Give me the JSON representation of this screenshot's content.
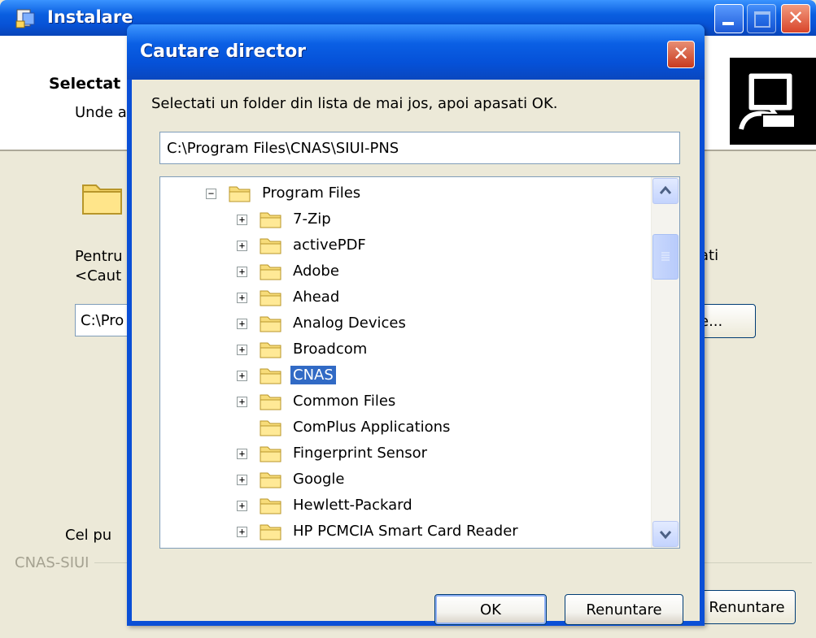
{
  "background_window": {
    "title": "Instalare",
    "header_title": "Selectat",
    "header_subtitle": "Unde a",
    "text_line1": "Pentru",
    "text_line2": "<Caut",
    "text_right": "ati",
    "path_value": "C:\\Pro",
    "browse_label": "e...",
    "space_label": "Cel pu",
    "group_label": "CNAS-SIUI",
    "cancel_label": "Renuntare"
  },
  "dialog": {
    "title": "Cautare director",
    "instruction": "Selectati un folder din lista de mai jos, apoi apasati OK.",
    "path_value": "C:\\Program Files\\CNAS\\SIUI-PNS",
    "tree": {
      "parent": "Program Files",
      "items": [
        {
          "label": "7-Zip",
          "expandable": true,
          "selected": false
        },
        {
          "label": "activePDF",
          "expandable": true,
          "selected": false
        },
        {
          "label": "Adobe",
          "expandable": true,
          "selected": false
        },
        {
          "label": "Ahead",
          "expandable": true,
          "selected": false
        },
        {
          "label": "Analog Devices",
          "expandable": true,
          "selected": false
        },
        {
          "label": "Broadcom",
          "expandable": true,
          "selected": false
        },
        {
          "label": "CNAS",
          "expandable": true,
          "selected": true
        },
        {
          "label": "Common Files",
          "expandable": true,
          "selected": false
        },
        {
          "label": "ComPlus Applications",
          "expandable": false,
          "selected": false
        },
        {
          "label": "Fingerprint Sensor",
          "expandable": true,
          "selected": false
        },
        {
          "label": "Google",
          "expandable": true,
          "selected": false
        },
        {
          "label": "Hewlett-Packard",
          "expandable": true,
          "selected": false
        },
        {
          "label": "HP PCMCIA Smart Card Reader",
          "expandable": true,
          "selected": false
        }
      ]
    },
    "ok_label": "OK",
    "cancel_label": "Renuntare"
  },
  "colors": {
    "titlebar": "#0a5fe0",
    "selection": "#316ac5",
    "window_bg": "#ece9d8"
  }
}
